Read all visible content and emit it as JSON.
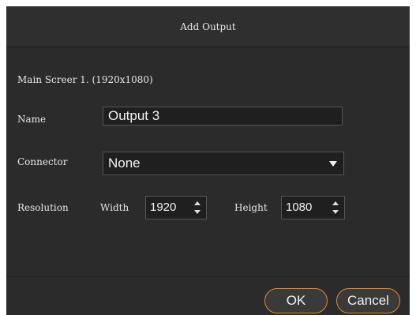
{
  "dialog": {
    "title": "Add Output",
    "screen_info": "Main Screer 1. (1920x1080)",
    "name": {
      "label": "Name",
      "value": "Output 3"
    },
    "connector": {
      "label": "Connector",
      "value": "None"
    },
    "resolution": {
      "label": "Resolution",
      "width_label": "Width",
      "width_value": "1920",
      "height_label": "Height",
      "height_value": "1080"
    },
    "buttons": {
      "ok": "OK",
      "cancel": "Cancel"
    },
    "colors": {
      "background": "#2b2b2b",
      "button_border": "#e08a2f"
    }
  }
}
